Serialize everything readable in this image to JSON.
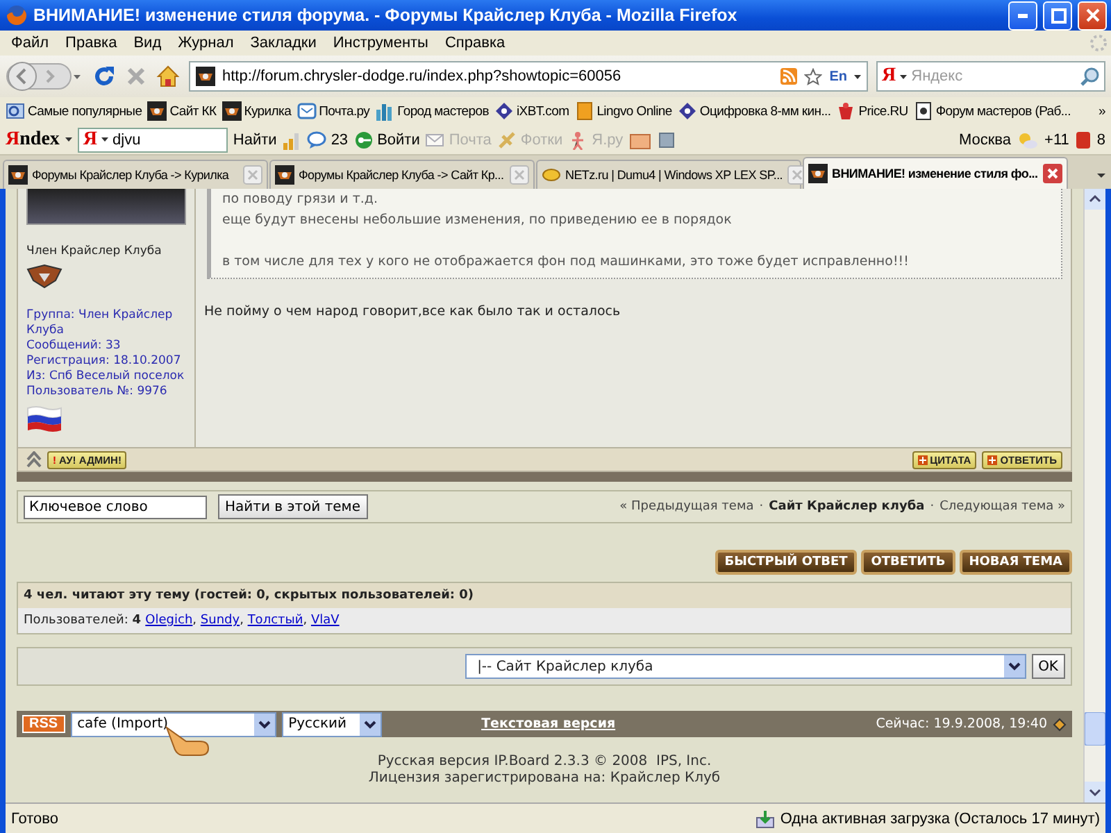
{
  "window": {
    "title": "ВНИМАНИЕ! изменение стиля форума. - Форумы Крайслер Клуба - Mozilla Firefox"
  },
  "menu": [
    "Файл",
    "Правка",
    "Вид",
    "Журнал",
    "Закладки",
    "Инструменты",
    "Справка"
  ],
  "navigation": {
    "url": "http://forum.chrysler-dodge.ru/index.php?showtopic=60056",
    "language": "En",
    "search_mark": "Я",
    "search_placeholder": "Яндекс"
  },
  "bookmarks": [
    {
      "label": "Самые популярные",
      "kind": "popular"
    },
    {
      "label": "Сайт КК",
      "kind": "forum"
    },
    {
      "label": "Курилка",
      "kind": "forum"
    },
    {
      "label": "Почта.ру",
      "kind": "mail"
    },
    {
      "label": "Город мастеров",
      "kind": "city"
    },
    {
      "label": "iXBT.com",
      "kind": "diamond"
    },
    {
      "label": "Lingvo Online",
      "kind": "book"
    },
    {
      "label": "Оцифровка 8-мм кин...",
      "kind": "diamond"
    },
    {
      "label": "Price.RU",
      "kind": "gift"
    },
    {
      "label": "Форум мастеров (Раб...",
      "kind": "page"
    }
  ],
  "more_bookmarks": "»",
  "yandex_bar": {
    "logo_mark": "Я",
    "logo_text": "ndex",
    "query_mark": "Я",
    "query": "djvu",
    "find": "Найти",
    "messages": "23",
    "items": [
      {
        "label": "Войти",
        "kind": "login",
        "disabled": false
      },
      {
        "label": "Почта",
        "kind": "mail",
        "disabled": true
      },
      {
        "label": "Фотки",
        "kind": "photos",
        "disabled": true
      },
      {
        "label": "Я.ру",
        "kind": "person",
        "disabled": true
      }
    ],
    "city": "Москва",
    "temperature": "+11",
    "badge": "8"
  },
  "tabs": [
    {
      "label": "Форумы Крайслер Клуба -> Курилка",
      "selected": false
    },
    {
      "label": "Форумы Крайслер Клуба -> Сайт Кр...",
      "selected": false
    },
    {
      "label": "NETz.ru | Dumu4 | Windows XP LEX SP...",
      "selected": false
    },
    {
      "label": "ВНИМАНИЕ! изменение стиля фо...",
      "selected": true
    }
  ],
  "post": {
    "author_title": "Член Крайслер Клуба",
    "details": [
      "Группа: Член Крайслер Клуба",
      "Сообщений: 33",
      "Регистрация: 18.10.2007",
      "Из: Спб Веселый поселок",
      "Пользователь №: 9976"
    ],
    "quote_paragraphs": [
      [
        "по поводу грязи и т.д.",
        "еще будут внесены небольшие изменения, по приведению ее в порядок"
      ],
      [
        "в том числе для тех у кого не отображается фон под машинками, это тоже будет исправленно!!!"
      ]
    ],
    "text": "Не пойму о чем народ говорит,все как было так и осталось",
    "report_mark": "!",
    "report": "АУ! АДМИН!",
    "actions": [
      "ЦИТАТА",
      "ОТВЕТИТЬ"
    ]
  },
  "topic_search": {
    "value": "Ключевое слово",
    "button": "Найти в этой теме"
  },
  "topic_nav": [
    {
      "text": "« Предыдущая тема",
      "kind": "link"
    },
    {
      "text": "·",
      "kind": "separator"
    },
    {
      "text": "Сайт Крайслер клуба",
      "kind": "current"
    },
    {
      "text": "·",
      "kind": "separator"
    },
    {
      "text": "Следующая тема »",
      "kind": "link"
    }
  ],
  "topic_buttons": [
    "БЫСТРЫЙ ОТВЕТ",
    "ОТВЕТИТЬ",
    "НОВАЯ ТЕМА"
  ],
  "readers": {
    "title": "4 чел. читают эту тему (гостей: 0, скрытых пользователей: 0)",
    "label": "Пользователей:",
    "count": "4",
    "users": [
      {
        "name": "Olegich",
        "separator": ","
      },
      {
        "name": "Sundy",
        "separator": ","
      },
      {
        "name": "Толстый",
        "separator": ","
      },
      {
        "name": "VlaV"
      }
    ]
  },
  "forum_jump": {
    "value": "|-- Сайт Крайслер клуба",
    "button": "OK"
  },
  "footer": {
    "rss": "RSS",
    "skin": "cafe (Import)",
    "language": "Русский",
    "text_version": "Текстовая версия",
    "time": "Сейчас: 19.9.2008, 19:40"
  },
  "copyright": [
    "Русская версия IP.Board 2.3.3 © 2008  IPS, Inc.",
    "Лицензия зарегистрирована на: Крайслер Клуб"
  ],
  "status_bar": {
    "text": "Готово",
    "downloads": "Одна активная загрузка (Осталось 17 минут)"
  }
}
